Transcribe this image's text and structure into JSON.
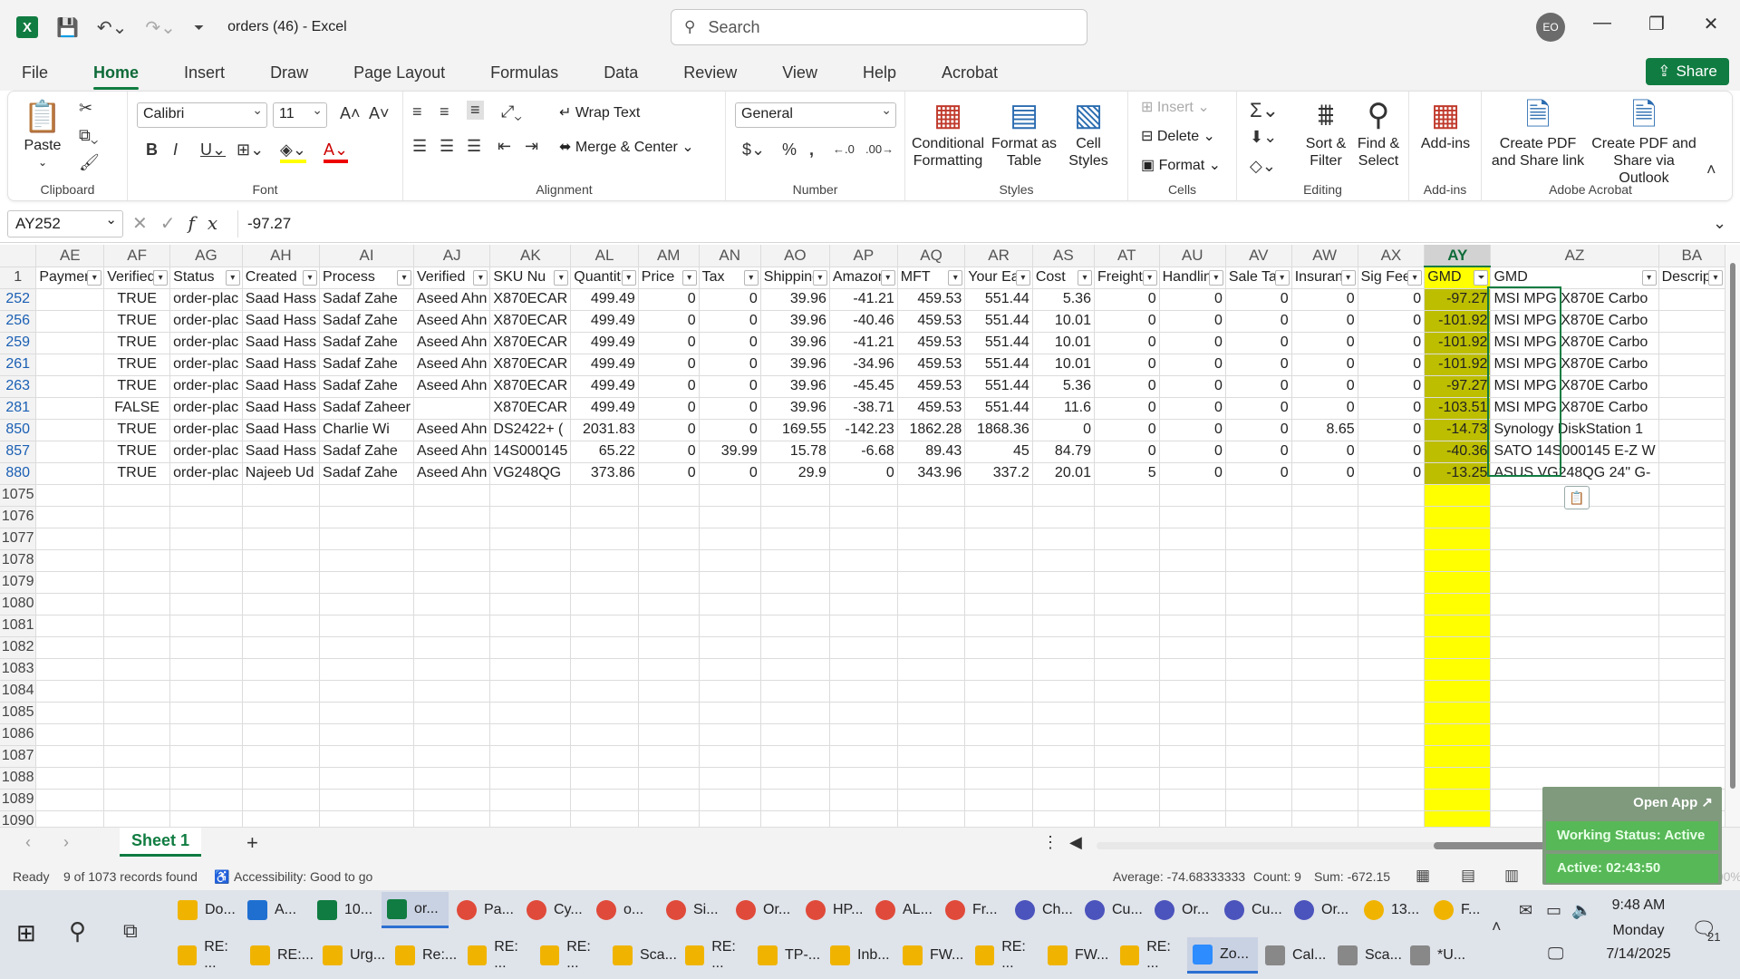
{
  "window": {
    "doc_title": "orders (46)  -  Excel",
    "search_placeholder": "Search",
    "avatar_initials": "EO"
  },
  "tabs": [
    "File",
    "Home",
    "Insert",
    "Draw",
    "Page Layout",
    "Formulas",
    "Data",
    "Review",
    "View",
    "Help",
    "Acrobat"
  ],
  "active_tab": "Home",
  "share_label": "Share",
  "ribbon": {
    "clipboard": {
      "label": "Clipboard",
      "paste": "Paste"
    },
    "font": {
      "label": "Font",
      "name": "Calibri",
      "size": "11"
    },
    "alignment": {
      "label": "Alignment",
      "wrap": "Wrap Text",
      "merge": "Merge & Center"
    },
    "number": {
      "label": "Number",
      "format": "General"
    },
    "styles": {
      "label": "Styles",
      "cond": "Conditional Formatting",
      "table": "Format as Table",
      "cell": "Cell Styles"
    },
    "cells": {
      "label": "Cells",
      "insert": "Insert",
      "delete": "Delete",
      "format": "Format"
    },
    "editing": {
      "label": "Editing",
      "sort": "Sort & Filter",
      "find": "Find & Select"
    },
    "addins": {
      "label": "Add-ins",
      "btn": "Add-ins"
    },
    "acrobat": {
      "label": "Adobe Acrobat",
      "pdf_link": "Create PDF and Share link",
      "pdf_outlook": "Create PDF and Share via Outlook"
    }
  },
  "formula_bar": {
    "name_box": "AY252",
    "formula": "-97.27"
  },
  "columns": [
    "AE",
    "AF",
    "AG",
    "AH",
    "AI",
    "AJ",
    "AK",
    "AL",
    "AM",
    "AN",
    "AO",
    "AP",
    "AQ",
    "AR",
    "AS",
    "AT",
    "AU",
    "AV",
    "AW",
    "AX",
    "AY",
    "AZ",
    "BA"
  ],
  "header_row": [
    "Paymen",
    "Verified",
    "Status",
    "Created",
    "Process",
    "Verified",
    "SKU Nu",
    "Quantit",
    "Price",
    "Tax",
    "Shipping",
    "Amazon",
    "MFT",
    "Your Ea",
    "Cost",
    "Freight",
    "Handlin",
    "Sale Ta",
    "Insuran",
    "Sig Fee",
    "GMD",
    "GMD",
    "Descrip"
  ],
  "data_rows": [
    {
      "row": "252",
      "cells": [
        "",
        "TRUE",
        "order-plac",
        "Saad Hass",
        "Sadaf Zahe",
        "Aseed Ahn",
        "X870ECAR",
        "499.49",
        "0",
        "0",
        "39.96",
        "-41.21",
        "459.53",
        "551.44",
        "5.36",
        "0",
        "0",
        "0",
        "0",
        "0",
        "-97.27",
        "MSI MPG X870E Carbo",
        ""
      ]
    },
    {
      "row": "256",
      "cells": [
        "",
        "TRUE",
        "order-plac",
        "Saad Hass",
        "Sadaf Zahe",
        "Aseed Ahn",
        "X870ECAR",
        "499.49",
        "0",
        "0",
        "39.96",
        "-40.46",
        "459.53",
        "551.44",
        "10.01",
        "0",
        "0",
        "0",
        "0",
        "0",
        "-101.92",
        "MSI MPG X870E Carbo",
        ""
      ]
    },
    {
      "row": "259",
      "cells": [
        "",
        "TRUE",
        "order-plac",
        "Saad Hass",
        "Sadaf Zahe",
        "Aseed Ahn",
        "X870ECAR",
        "499.49",
        "0",
        "0",
        "39.96",
        "-41.21",
        "459.53",
        "551.44",
        "10.01",
        "0",
        "0",
        "0",
        "0",
        "0",
        "-101.92",
        "MSI MPG X870E Carbo",
        ""
      ]
    },
    {
      "row": "261",
      "cells": [
        "",
        "TRUE",
        "order-plac",
        "Saad Hass",
        "Sadaf Zahe",
        "Aseed Ahn",
        "X870ECAR",
        "499.49",
        "0",
        "0",
        "39.96",
        "-34.96",
        "459.53",
        "551.44",
        "10.01",
        "0",
        "0",
        "0",
        "0",
        "0",
        "-101.92",
        "MSI MPG X870E Carbo",
        ""
      ]
    },
    {
      "row": "263",
      "cells": [
        "",
        "TRUE",
        "order-plac",
        "Saad Hass",
        "Sadaf Zahe",
        "Aseed Ahn",
        "X870ECAR",
        "499.49",
        "0",
        "0",
        "39.96",
        "-45.45",
        "459.53",
        "551.44",
        "5.36",
        "0",
        "0",
        "0",
        "0",
        "0",
        "-97.27",
        "MSI MPG X870E Carbo",
        ""
      ]
    },
    {
      "row": "281",
      "cells": [
        "",
        "FALSE",
        "order-plac",
        "Saad Hass",
        "Sadaf Zaheer",
        "",
        "X870ECAR",
        "499.49",
        "0",
        "0",
        "39.96",
        "-38.71",
        "459.53",
        "551.44",
        "11.6",
        "0",
        "0",
        "0",
        "0",
        "0",
        "-103.51",
        "MSI MPG X870E Carbo",
        ""
      ]
    },
    {
      "row": "850",
      "cells": [
        "",
        "TRUE",
        "order-plac",
        "Saad Hass",
        "Charlie Wi",
        "Aseed Ahn",
        "DS2422+ (",
        "2031.83",
        "0",
        "0",
        "169.55",
        "-142.23",
        "1862.28",
        "1868.36",
        "0",
        "0",
        "0",
        "0",
        "8.65",
        "0",
        "-14.73",
        "Synology DiskStation 1",
        ""
      ]
    },
    {
      "row": "857",
      "cells": [
        "",
        "TRUE",
        "order-plac",
        "Saad Hass",
        "Sadaf Zahe",
        "Aseed Ahn",
        "14S000145",
        "65.22",
        "0",
        "39.99",
        "15.78",
        "-6.68",
        "89.43",
        "45",
        "84.79",
        "0",
        "0",
        "0",
        "0",
        "0",
        "-40.36",
        "SATO 14S000145 E-Z W",
        ""
      ]
    },
    {
      "row": "880",
      "cells": [
        "",
        "TRUE",
        "order-plac",
        "Najeeb Ud",
        "Sadaf Zahe",
        "Aseed Ahn",
        "VG248QG",
        "373.86",
        "0",
        "0",
        "29.9",
        "0",
        "343.96",
        "337.2",
        "20.01",
        "5",
        "0",
        "0",
        "0",
        "0",
        "-13.25",
        "ASUS VG248QG 24\" G-",
        ""
      ]
    }
  ],
  "empty_rows": [
    "1075",
    "1076",
    "1077",
    "1078",
    "1079",
    "1080",
    "1081",
    "1082",
    "1083",
    "1084",
    "1085",
    "1086",
    "1087",
    "1088",
    "1089",
    "1090"
  ],
  "sheet_tab": "Sheet 1",
  "status": {
    "ready": "Ready",
    "records": "9 of 1073 records found",
    "accessibility": "Accessibility: Good to go",
    "average": "Average: -74.68333333",
    "count": "Count: 9",
    "sum": "Sum: -672.15",
    "zoom": "100%"
  },
  "widget": {
    "open_app": "Open App ↗",
    "working": "Working Status: Active",
    "active": "Active: 02:43:50"
  },
  "taskbar": {
    "row1": [
      "Do...",
      "A...",
      "10...",
      "or...",
      "Pa...",
      "Cy...",
      "o...",
      "Si...",
      "Or...",
      "HP...",
      "AL...",
      "Fr...",
      "Ch...",
      "Cu...",
      "Or...",
      "Cu...",
      "Or...",
      "13...",
      "F..."
    ],
    "row2": [
      "RE: ...",
      "RE:...",
      "Urg...",
      "Re:...",
      "RE: ...",
      "RE: ...",
      "Sca...",
      "RE: ...",
      "TP-...",
      "Inb...",
      "FW...",
      "RE: ...",
      "FW...",
      "RE: ...",
      "Zo...",
      "Cal...",
      "Sca...",
      "*U..."
    ],
    "time": "9:48 AM",
    "day": "Monday",
    "date": "7/14/2025",
    "notif_count": "21"
  },
  "colors": {
    "accent": "#107c41",
    "highlight": "#ffff00",
    "selected_col": "#bdbe00"
  }
}
